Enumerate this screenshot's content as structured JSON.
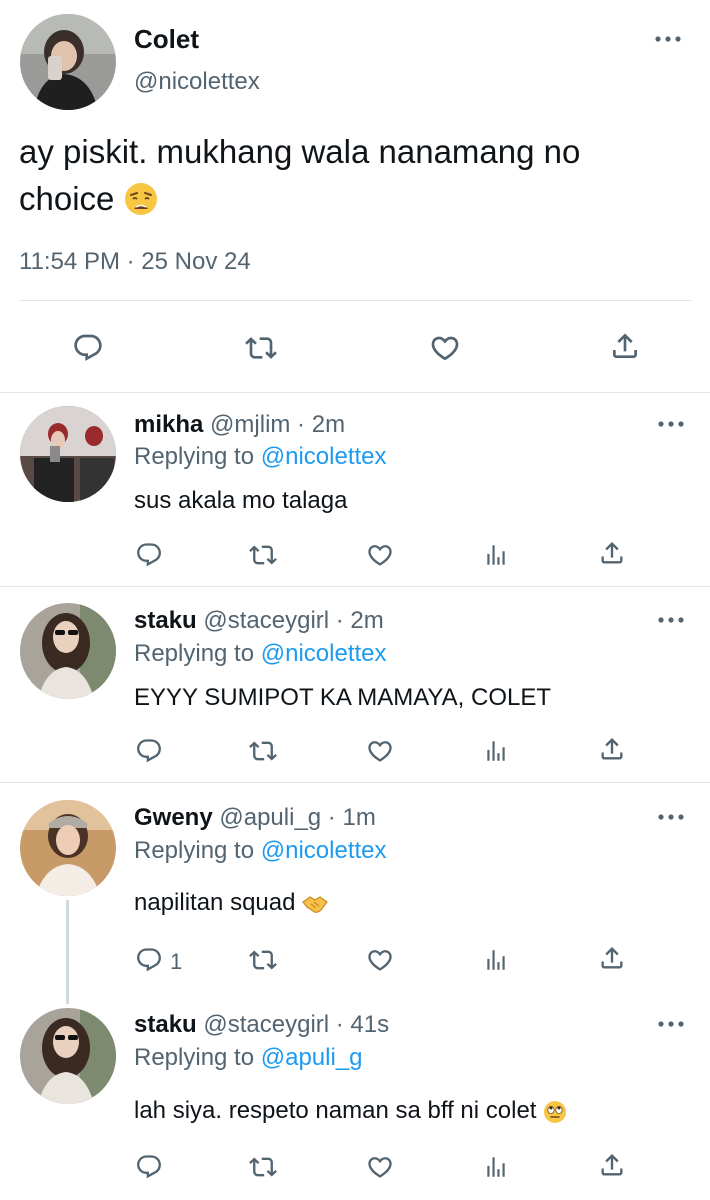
{
  "tweet": {
    "name": "Colet",
    "handle": "@nicolettex",
    "text": "ay piskit. mukhang wala nanamang no choice",
    "emoji": "weary-face-emoji",
    "timestamp": "11:54 PM · 25 Nov 24",
    "actions": [
      "reply-icon",
      "retweet-icon",
      "like-icon",
      "share-icon"
    ]
  },
  "replies": [
    {
      "name": "mikha",
      "meta": "@mjlim · 2m",
      "replying_prefix": "Replying to",
      "replying_to": "@nicolettex",
      "text": "sus akala mo talaga",
      "reply_count": ""
    },
    {
      "name": "staku",
      "meta": "@staceygirl · 2m",
      "replying_prefix": "Replying to",
      "replying_to": "@nicolettex",
      "text": "EYYY SUMIPOT KA MAMAYA, COLET",
      "reply_count": ""
    },
    {
      "name": "Gweny",
      "meta": "@apuli_g · 1m",
      "replying_prefix": "Replying to",
      "replying_to": "@nicolettex",
      "text": "napilitan squad",
      "emoji": "handshake-emoji",
      "reply_count": "1"
    },
    {
      "name": "staku",
      "meta": "@staceygirl · 41s",
      "replying_prefix": "Replying to",
      "replying_to": "@apuli_g",
      "text": "lah siya. respeto naman sa bff ni colet",
      "emoji": "eye-roll-emoji",
      "reply_count": ""
    }
  ],
  "colors": {
    "text": "#0f1419",
    "secondary": "#536471",
    "link": "#1d9bf0",
    "divider": "#e1e6ea"
  }
}
